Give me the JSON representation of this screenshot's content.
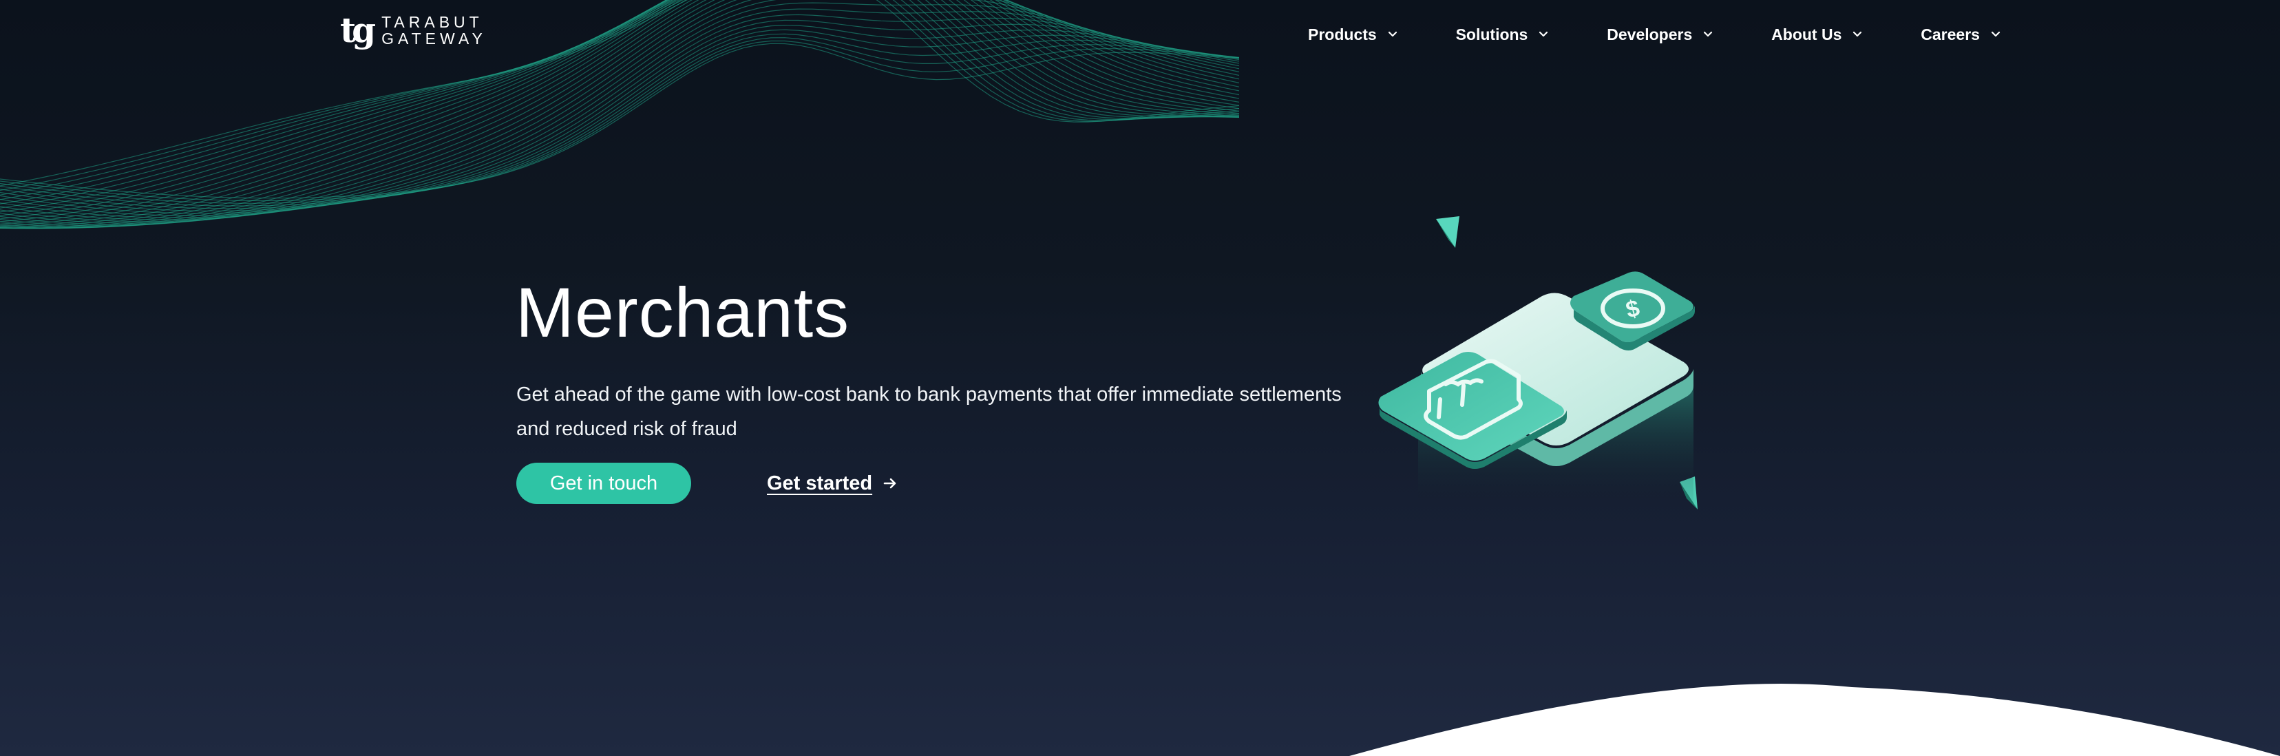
{
  "brand": {
    "mark": "tg",
    "name_line1": "TARABUT",
    "name_line2": "GATEWAY"
  },
  "nav": {
    "items": [
      {
        "label": "Products"
      },
      {
        "label": "Solutions"
      },
      {
        "label": "Developers"
      },
      {
        "label": "About Us"
      },
      {
        "label": "Careers"
      }
    ]
  },
  "hero": {
    "title": "Merchants",
    "subtitle": "Get ahead of the game with low-cost bank to bank payments that offer immediate settlements and reduced risk of fraud",
    "primary_button": "Get in touch",
    "secondary_link": "Get started"
  },
  "colors": {
    "accent": "#2ec4a5",
    "background_top": "#0b121c",
    "background_bottom": "#1f2940",
    "wave": "#1fa386"
  },
  "icons": {
    "nav_dropdown": "chevron-down-icon",
    "link_arrow": "arrow-right-icon",
    "illustration_coin": "dollar-icon",
    "illustration_store": "storefront-icon"
  }
}
